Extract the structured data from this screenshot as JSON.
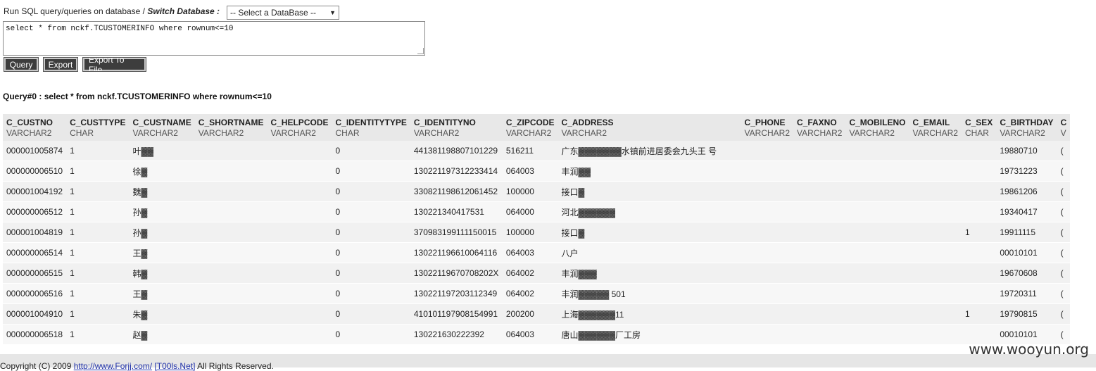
{
  "header": {
    "prompt": "Run SQL query/queries on database / ",
    "switch_label": "Switch Database :",
    "db_select_value": "-- Select a DataBase --"
  },
  "query": {
    "sql_text": "select * from nckf.TCUSTOMERINFO where rownum<=10"
  },
  "buttons": {
    "query": "Query",
    "export": "Export",
    "export_file": "Export To File"
  },
  "result_title": "Query#0 : select * from nckf.TCUSTOMERINFO where rownum<=10",
  "columns": [
    {
      "name": "C_CUSTNO",
      "type": "VARCHAR2"
    },
    {
      "name": "C_CUSTTYPE",
      "type": "CHAR"
    },
    {
      "name": "C_CUSTNAME",
      "type": "VARCHAR2"
    },
    {
      "name": "C_SHORTNAME",
      "type": "VARCHAR2"
    },
    {
      "name": "C_HELPCODE",
      "type": "VARCHAR2"
    },
    {
      "name": "C_IDENTITYTYPE",
      "type": "CHAR"
    },
    {
      "name": "C_IDENTITYNO",
      "type": "VARCHAR2"
    },
    {
      "name": "C_ZIPCODE",
      "type": "VARCHAR2"
    },
    {
      "name": "C_ADDRESS",
      "type": "VARCHAR2"
    },
    {
      "name": "C_PHONE",
      "type": "VARCHAR2"
    },
    {
      "name": "C_FAXNO",
      "type": "VARCHAR2"
    },
    {
      "name": "C_MOBILENO",
      "type": "VARCHAR2"
    },
    {
      "name": "C_EMAIL",
      "type": "VARCHAR2"
    },
    {
      "name": "C_SEX",
      "type": "CHAR"
    },
    {
      "name": "C_BIRTHDAY",
      "type": "VARCHAR2"
    },
    {
      "name": "C",
      "type": "V"
    }
  ],
  "rows": [
    [
      "000001005874",
      "1",
      "叶▓▓",
      "",
      "",
      "0",
      "441381198807101229",
      "516211",
      "广东▓▓▓▓▓▓▓水镇前进居委会九头王 号",
      "",
      "",
      "",
      "",
      "",
      "19880710",
      "("
    ],
    [
      "000000006510",
      "1",
      "徐▓",
      "",
      "",
      "0",
      "130221197312233414",
      "064003",
      "丰润▓▓",
      "",
      "",
      "",
      "",
      "",
      "19731223",
      "("
    ],
    [
      "000001004192",
      "1",
      "魏▓",
      "",
      "",
      "0",
      "330821198612061452",
      "100000",
      "接口▓",
      "",
      "",
      "",
      "",
      "",
      "19861206",
      "("
    ],
    [
      "000000006512",
      "1",
      "孙▓",
      "",
      "",
      "0",
      "130221340417531",
      "064000",
      "河北▓▓▓▓▓▓",
      "",
      "",
      "",
      "",
      "",
      "19340417",
      "("
    ],
    [
      "000001004819",
      "1",
      "孙▓",
      "",
      "",
      "0",
      "370983199111150015",
      "100000",
      "接口▓",
      "",
      "",
      "",
      "",
      "1",
      "19911115",
      "("
    ],
    [
      "000000006514",
      "1",
      "王▓",
      "",
      "",
      "0",
      "130221196610064116",
      "064003",
      "八户",
      "",
      "",
      "",
      "",
      "",
      "00010101",
      "("
    ],
    [
      "000000006515",
      "1",
      "韩▓",
      "",
      "",
      "0",
      "13022119670708202X",
      "064002",
      "丰润▓▓▓",
      "",
      "",
      "",
      "",
      "",
      "19670608",
      "("
    ],
    [
      "000000006516",
      "1",
      "王▓",
      "",
      "",
      "0",
      "130221197203112349",
      "064002",
      "丰润▓▓▓▓▓ 501",
      "",
      "",
      "",
      "",
      "",
      "19720311",
      "("
    ],
    [
      "000001004910",
      "1",
      "朱▓",
      "",
      "",
      "0",
      "410101197908154991",
      "200200",
      "上海▓▓▓▓▓▓11",
      "",
      "",
      "",
      "",
      "1",
      "19790815",
      "("
    ],
    [
      "000000006518",
      "1",
      "赵▓",
      "",
      "",
      "0",
      "130221630222392",
      "064003",
      "唐山▓▓▓▓▓▓厂工房",
      "",
      "",
      "",
      "",
      "",
      "00010101",
      "("
    ]
  ],
  "footer": {
    "prefix": "Copyright (C) 2009 ",
    "link1": "http://www.Forjj.com/",
    "link2": "[T00ls.Net]",
    "suffix": " All Rights Reserved."
  },
  "watermark": "www.wooyun.org"
}
